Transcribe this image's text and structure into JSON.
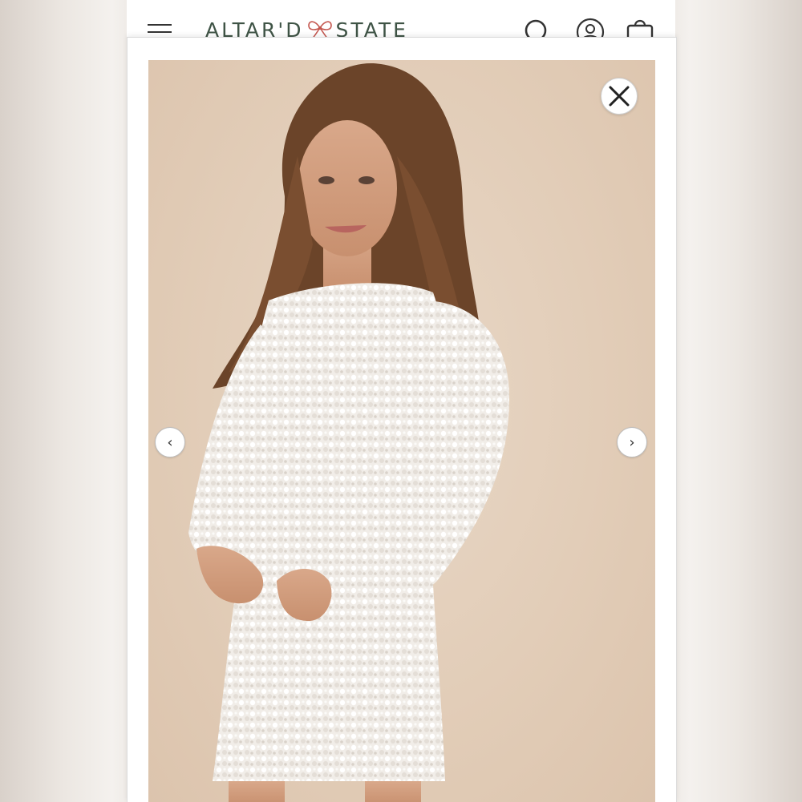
{
  "header": {
    "logo_left": "ALTAR'D",
    "logo_right": "STATE",
    "menu_icon": "hamburger-menu-icon",
    "search_icon": "search-icon",
    "account_icon": "account-icon",
    "bag_icon": "shopping-bag-icon"
  },
  "gallery": {
    "close_icon": "close-icon",
    "prev_label": "‹",
    "next_label": "›"
  },
  "colors": {
    "brand_green": "#3f5446",
    "bow_red": "#c4574f",
    "photo_background": "#e2cdb8",
    "dress_white": "#f4f1ee",
    "hair_brown": "#6b4429"
  }
}
